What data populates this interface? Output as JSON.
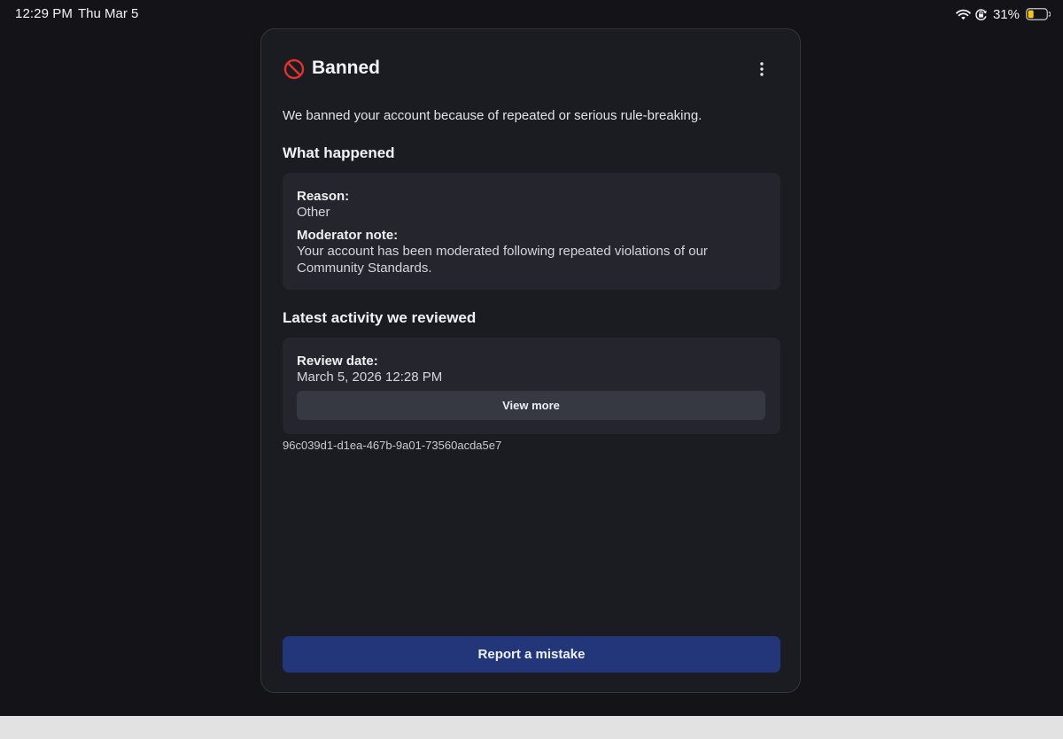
{
  "status_bar": {
    "time": "12:29 PM",
    "date": "Thu Mar 5",
    "battery_percent": "31%",
    "battery_level": 0.31,
    "icons": [
      "wifi-icon",
      "orientation-lock-icon",
      "battery-icon"
    ],
    "battery_color": "#f5c518"
  },
  "card": {
    "title": "Banned",
    "title_icon": "ban-icon",
    "ban_icon_color": "#e0322f",
    "menu_icon": "more-vertical-icon",
    "description": "We banned your account because of repeated or serious rule-breaking.",
    "what_happened": {
      "heading": "What happened",
      "reason_label": "Reason:",
      "reason_value": "Other",
      "note_label": "Moderator note:",
      "note_value": "Your account has been moderated following repeated violations of our Community Standards."
    },
    "latest_activity": {
      "heading": "Latest activity we reviewed",
      "review_date_label": "Review date:",
      "review_date_value": "March 5, 2026 12:28 PM",
      "view_more_label": "View more"
    },
    "case_id": "96c039d1-d1ea-467b-9a01-73560acda5e7",
    "report_button_label": "Report a mistake",
    "report_button_color": "#23367a"
  }
}
